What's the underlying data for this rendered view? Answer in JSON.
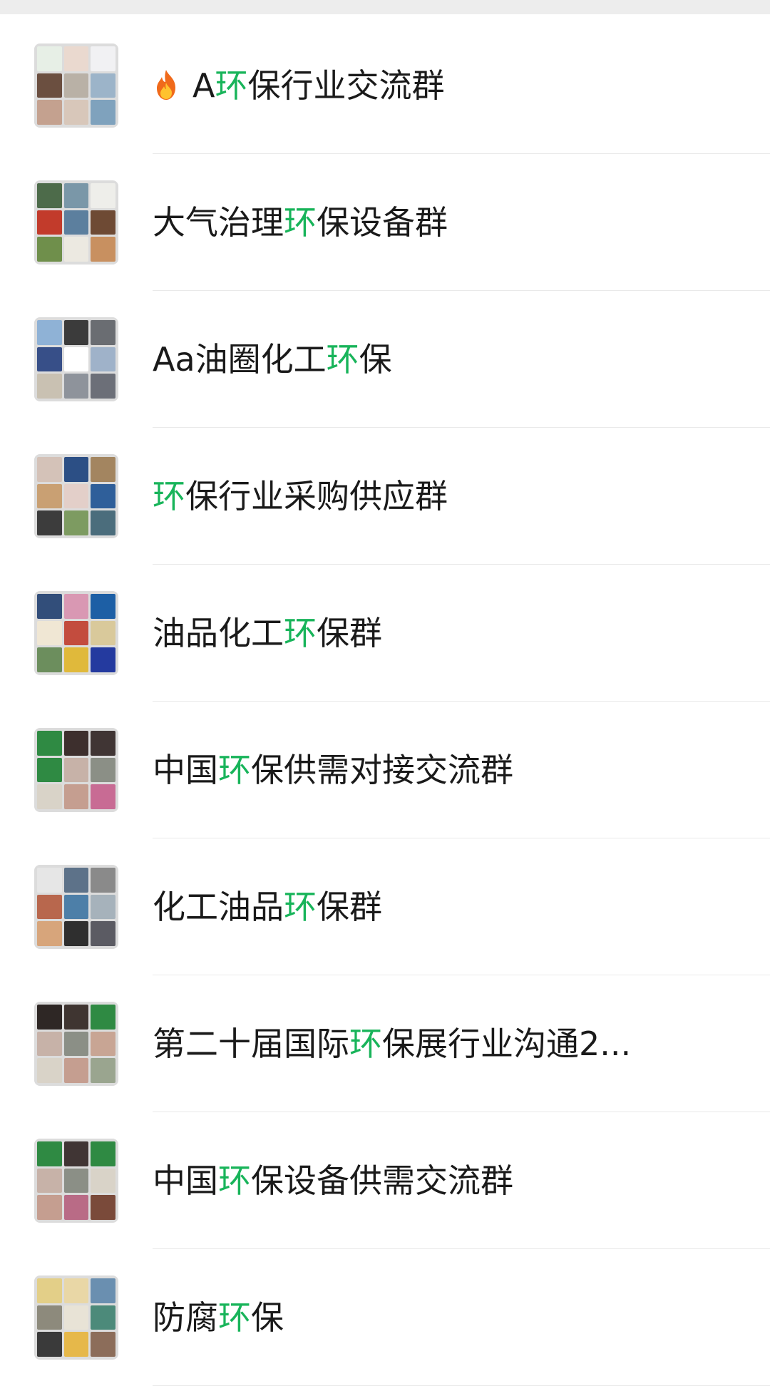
{
  "highlight_color": "#18b45a",
  "text_color": "#1a1a1a",
  "groups": [
    {
      "icon": "fire-icon",
      "pre": "A",
      "hl": "环",
      "post": "保行业交流群",
      "tiles": [
        "#e7efe6",
        "#ead9cf",
        "#f1f1f3",
        "#6b4f40",
        "#b9b1a6",
        "#9cb4c9",
        "#c4a18f",
        "#d8c7ba",
        "#7fa2bd"
      ]
    },
    {
      "icon": "",
      "pre": "大气治理",
      "hl": "环",
      "post": "保设备群",
      "tiles": [
        "#4d6b4a",
        "#7a97a8",
        "#eeeeea",
        "#c23b2b",
        "#5c7f9e",
        "#6e4a34",
        "#6f8f4b",
        "#ece9e1",
        "#c89060"
      ]
    },
    {
      "icon": "",
      "pre": "Aa油圈化工",
      "hl": "环",
      "post": "保",
      "tiles": [
        "#8fb2d6",
        "#3b3b3b",
        "#6a6d72",
        "#374f88",
        "#ffffff",
        "#9fb2c9",
        "#c9c1b2",
        "#8e939b",
        "#6c6f78"
      ]
    },
    {
      "icon": "",
      "pre": "",
      "hl": "环",
      "post": "保行业采购供应群",
      "tiles": [
        "#d4c2b8",
        "#2c4f85",
        "#a38560",
        "#c9a073",
        "#e3cfc9",
        "#2f5f9a",
        "#3c3c3c",
        "#7d9b61",
        "#4b6d7c"
      ]
    },
    {
      "icon": "",
      "pre": "油品化工",
      "hl": "环",
      "post": "保群",
      "tiles": [
        "#324e7a",
        "#d998b3",
        "#1d5fa5",
        "#f0e7d4",
        "#c34c3e",
        "#d9c99b",
        "#6c8e5d",
        "#e0b93b",
        "#243a9f"
      ]
    },
    {
      "icon": "",
      "pre": "中国",
      "hl": "环",
      "post": "保供需对接交流群",
      "tiles": [
        "#2f8a43",
        "#3d2f2d",
        "#403534",
        "#2f8a43",
        "#c7b2a8",
        "#8b8f86",
        "#d9d3c8",
        "#c59e90",
        "#c86b94"
      ]
    },
    {
      "icon": "",
      "pre": "化工油品",
      "hl": "环",
      "post": "保群",
      "tiles": [
        "#e6e6e6",
        "#5d7289",
        "#8a8a8a",
        "#b8674d",
        "#4d7fa8",
        "#a6b2bb",
        "#d7a57b",
        "#2f2f2f",
        "#5b5b63"
      ]
    },
    {
      "icon": "",
      "pre": "第二十届国际",
      "hl": "环",
      "post": "保展行业沟通2...",
      "tiles": [
        "#2e2725",
        "#3f3531",
        "#2f8a43",
        "#c7b2a8",
        "#8b8f86",
        "#c8a594",
        "#d9d3c8",
        "#c59e90",
        "#9aa58f"
      ]
    },
    {
      "icon": "",
      "pre": "中国",
      "hl": "环",
      "post": "保设备供需交流群",
      "tiles": [
        "#2f8a43",
        "#403534",
        "#2f8a43",
        "#c7b2a8",
        "#8b8f86",
        "#d9d3c8",
        "#c59e90",
        "#b96b86",
        "#7a4a3a"
      ]
    },
    {
      "icon": "",
      "pre": "防腐",
      "hl": "环",
      "post": "保",
      "tiles": [
        "#e3cf88",
        "#e9d7a6",
        "#6a8fb0",
        "#8d8a7c",
        "#e8e3d6",
        "#4c8a7a",
        "#3a3a3a",
        "#e6b84a",
        "#8c6d5a"
      ]
    }
  ]
}
